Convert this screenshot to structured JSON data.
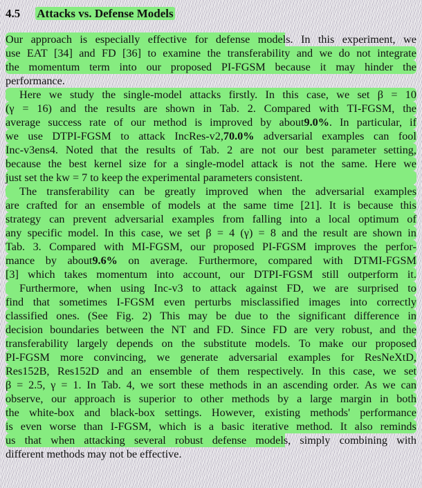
{
  "section": {
    "number": "4.5",
    "title": "Attacks vs. Defense Models"
  },
  "lines": [
    [
      {
        "t": "Our approach is especially effective for defense models. In this experiment, we"
      }
    ],
    [
      {
        "t": "use EAT [34] and FD [36] to examine the transferability and we do not integrate"
      }
    ],
    [
      {
        "t": "the momentum term into our proposed PI-FGSM because it may hinder the"
      }
    ],
    [
      {
        "t": "performance."
      }
    ],
    [
      {
        "t": "Here we study the single-model attacks firstly. In this case, we set β = 10"
      }
    ],
    [
      {
        "t": "(γ = 16) and the results are shown in Tab. 2. Compared with TI-FGSM, the"
      }
    ],
    [
      {
        "t": "average success rate of our method is improved by about "
      },
      {
        "t": "9.0%",
        "b": true
      },
      {
        "t": ". In particular, if"
      }
    ],
    [
      {
        "t": "we use DTPI-FGSM to attack IncRes-v2, "
      },
      {
        "t": "70.0%",
        "b": true
      },
      {
        "t": " adversarial examples can fool"
      }
    ],
    [
      {
        "t": "Inc-v3ens4. Noted that the results of Tab. 2 are not our best parameter setting,"
      }
    ],
    [
      {
        "t": "because the best kernel size for a single-model attack is not the same. Here we"
      }
    ],
    [
      {
        "t": "just set the kw = 7 to keep the experimental parameters consistent."
      }
    ],
    [
      {
        "t": "The transferability can be greatly improved when the adversarial examples"
      }
    ],
    [
      {
        "t": "are crafted for an ensemble of models at the same time [21]. It is because this"
      }
    ],
    [
      {
        "t": "strategy can prevent adversarial examples from falling into a local optimum of"
      }
    ],
    [
      {
        "t": "any specific model. In this case, we set β = 4 (γ) = 8 and the result are shown in"
      }
    ],
    [
      {
        "t": "Tab. 3. Compared with MI-FGSM, our proposed PI-FGSM improves the perfor-"
      }
    ],
    [
      {
        "t": "mance by about "
      },
      {
        "t": "9.6%",
        "b": true
      },
      {
        "t": " on average. Furthermore, compared with DTMI-FGSM"
      }
    ],
    [
      {
        "t": "[3] which takes momentum into account, our DTPI-FGSM still outperform it."
      }
    ],
    [
      {
        "t": "Furthermore, when using Inc-v3 to attack against FD, we are surprised to"
      }
    ],
    [
      {
        "t": "find that sometimes I-FGSM even perturbs misclassified images into correctly"
      }
    ],
    [
      {
        "t": "classified ones. (See Fig. 2) This may be due to the significant difference in"
      }
    ],
    [
      {
        "t": "decision boundaries between the NT and FD. Since FD are very robust, and the"
      }
    ],
    [
      {
        "t": "transferability largely depends on the substitute models. To make our proposed"
      }
    ],
    [
      {
        "t": "PI-FGSM more convincing, we generate adversarial examples for ResNeXtD,"
      }
    ],
    [
      {
        "t": "Res152B, Res152D and an ensemble of them respectively. In this case, we set"
      }
    ],
    [
      {
        "t": "β = 2.5, γ = 1. In Tab. 4, we sort these methods in an ascending order. As we can"
      }
    ],
    [
      {
        "t": "observe, our approach is superior to other methods by a large margin in both"
      }
    ],
    [
      {
        "t": "the white-box and black-box settings. However, existing methods' performance"
      }
    ],
    [
      {
        "t": "is even worse than I-FGSM, which is a basic iterative method. It also reminds"
      }
    ],
    [
      {
        "t": "us that when attacking several robust defense models, simply combining with"
      }
    ],
    [
      {
        "t": "different methods may not be effective."
      }
    ]
  ],
  "highlight_color": "#86ec80"
}
